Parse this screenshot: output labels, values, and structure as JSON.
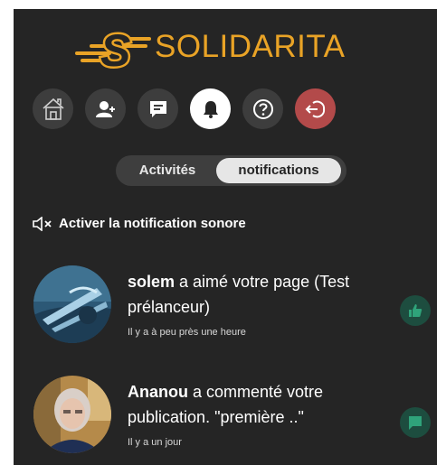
{
  "brand": {
    "name": "SOLIDARITA"
  },
  "nav": [
    {
      "icon": "home-icon"
    },
    {
      "icon": "add-contact-icon"
    },
    {
      "icon": "message-icon"
    },
    {
      "icon": "bell-icon",
      "active": true
    },
    {
      "icon": "help-icon"
    },
    {
      "icon": "logout-icon"
    }
  ],
  "tabs": {
    "activites": "Activités",
    "notifications": "notifications",
    "selected": "notifications"
  },
  "sound": {
    "label": "Activer la notification sonore",
    "icon": "speaker-muted-icon"
  },
  "notifications": [
    {
      "user": "solem",
      "message": " a aimé votre page (Test prélanceur)",
      "time": "Il y a à peu près une heure",
      "type_icon": "thumbs-up-icon"
    },
    {
      "user": "Ananou",
      "message": " a commenté votre publication. \"première ..\"",
      "time": "Il y a un jour",
      "type_icon": "comment-icon"
    }
  ],
  "colors": {
    "panel": "#252525",
    "brand": "#e9a326",
    "button": "#3d3d3d",
    "active_button": "#ffffff",
    "logout": "#b34a4a",
    "badge": "#1d4d3f",
    "badge_icon": "#2fa37a"
  }
}
